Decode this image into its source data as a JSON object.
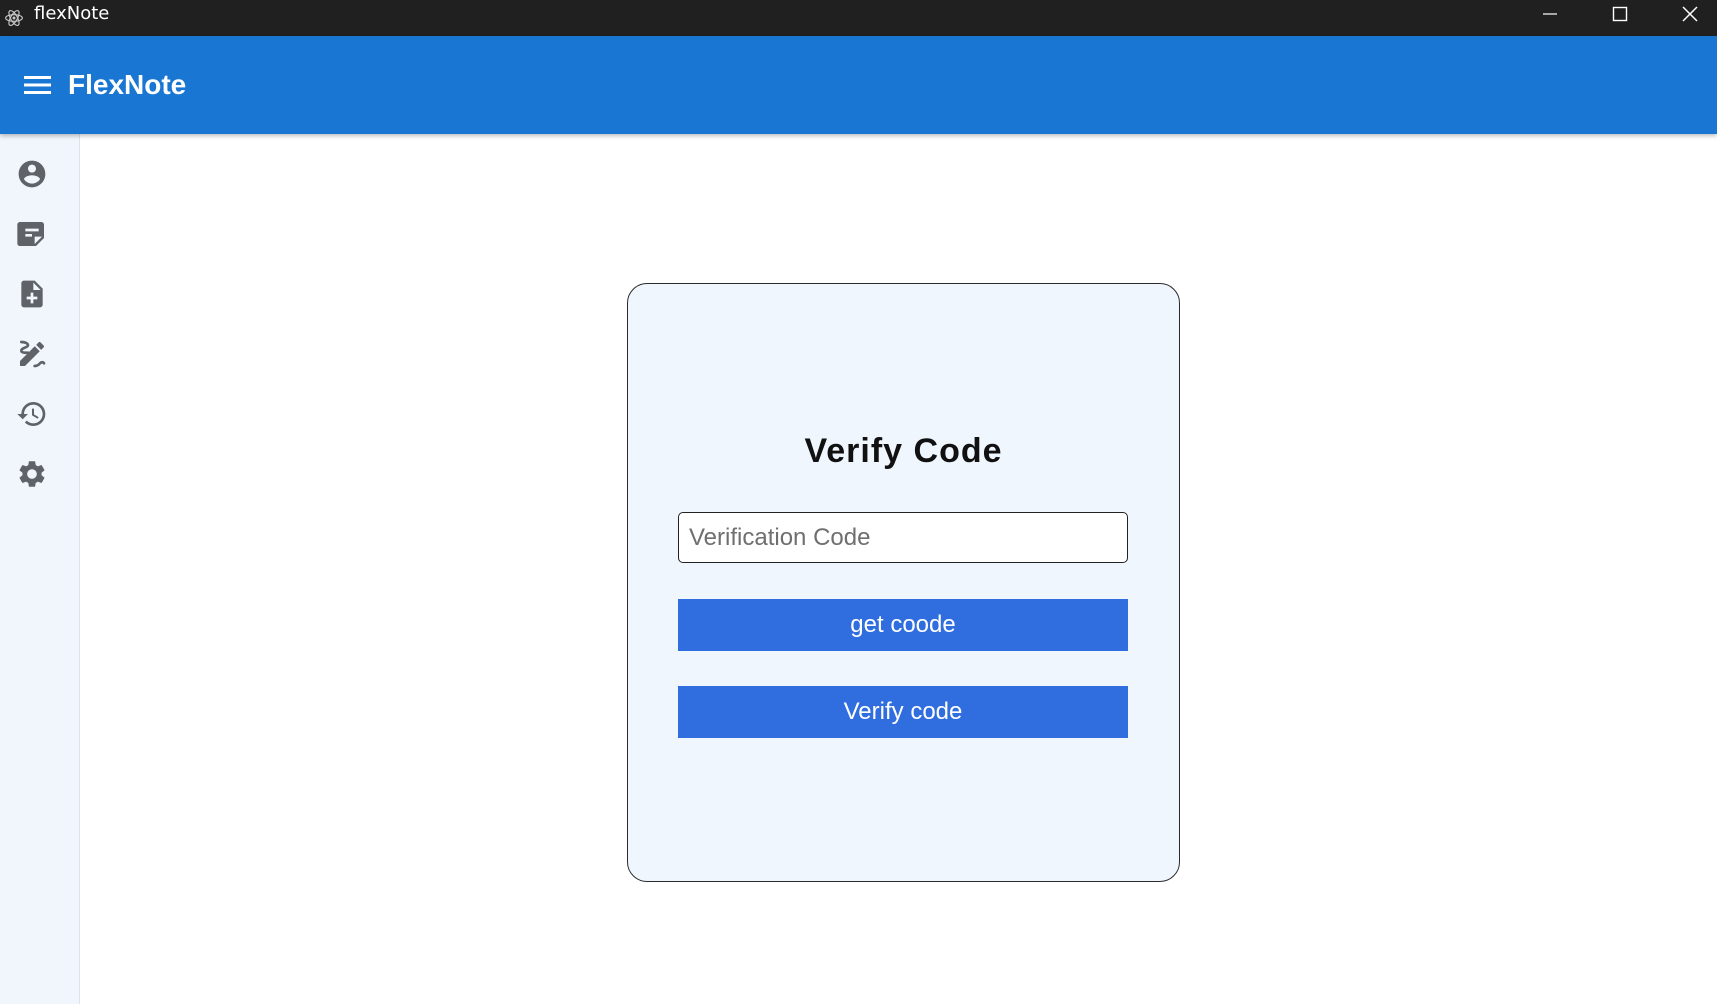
{
  "window": {
    "title": "flexNote",
    "app_icon": "electron-icon",
    "controls": [
      "minimize-icon",
      "maximize-icon",
      "close-icon"
    ]
  },
  "appbar": {
    "menu_icon": "hamburger-menu-icon",
    "title": "FlexNote",
    "color": "#1976d2"
  },
  "sidebar": {
    "items": [
      {
        "icon": "account-circle-icon"
      },
      {
        "icon": "notes-icon"
      },
      {
        "icon": "new-note-icon"
      },
      {
        "icon": "edit-note-icon"
      },
      {
        "icon": "history-icon"
      },
      {
        "icon": "settings-icon"
      }
    ]
  },
  "verify_card": {
    "title": "Verify Code",
    "code_input": {
      "placeholder": "Verification Code",
      "value": ""
    },
    "get_code_button": "get coode",
    "verify_button": "Verify code",
    "button_color": "#306ee0"
  }
}
